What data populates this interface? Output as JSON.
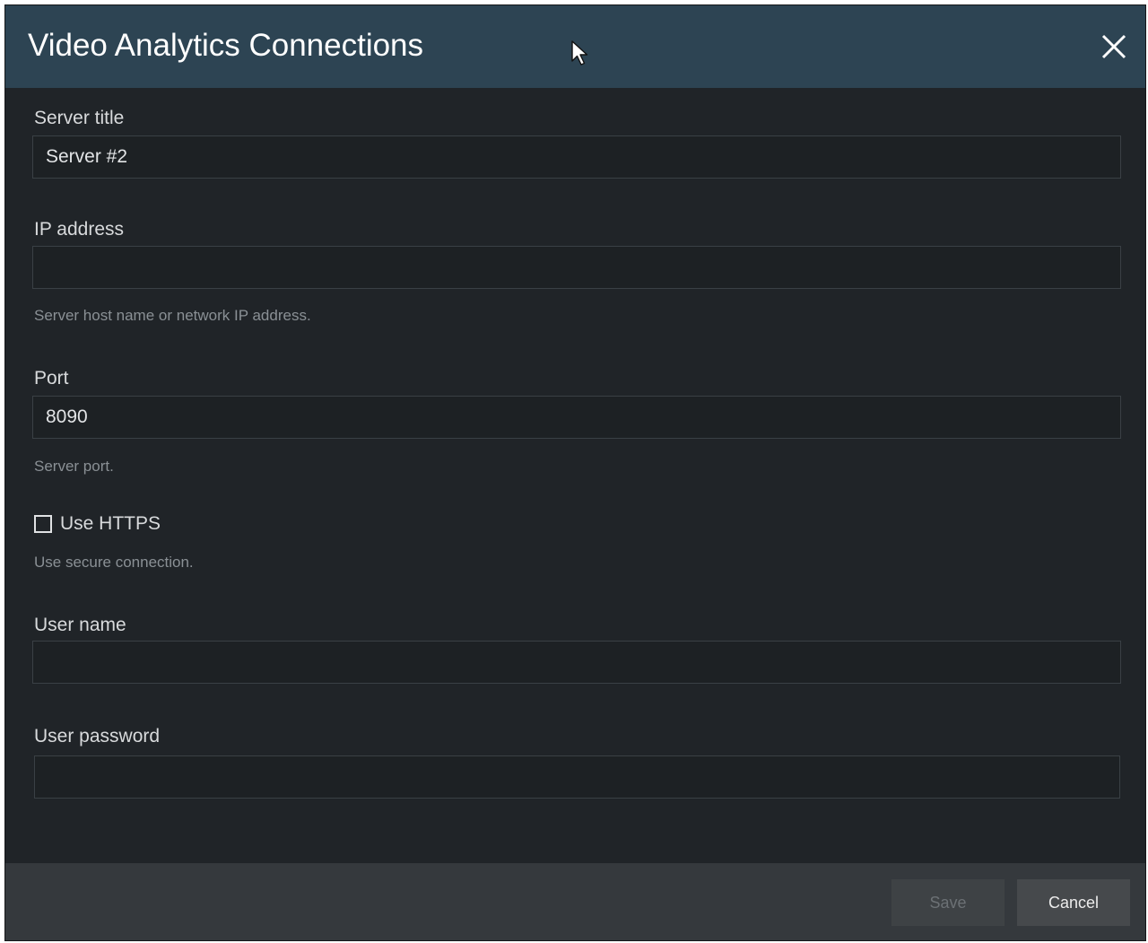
{
  "dialog": {
    "title": "Video Analytics Connections",
    "close_icon": "close-icon"
  },
  "fields": {
    "server_title": {
      "label": "Server title",
      "value": "Server #2"
    },
    "ip_address": {
      "label": "IP address",
      "value": "",
      "hint": "Server host name or network IP address."
    },
    "port": {
      "label": "Port",
      "value": "8090",
      "hint": "Server port."
    },
    "use_https": {
      "label": "Use HTTPS",
      "checked": false,
      "hint": "Use secure connection."
    },
    "user_name": {
      "label": "User name",
      "value": ""
    },
    "user_password": {
      "label": "User password",
      "value": ""
    }
  },
  "footer": {
    "save_label": "Save",
    "save_enabled": false,
    "cancel_label": "Cancel"
  },
  "colors": {
    "title_bar": "#2d4453",
    "body": "#202428",
    "footer": "#35393d"
  }
}
